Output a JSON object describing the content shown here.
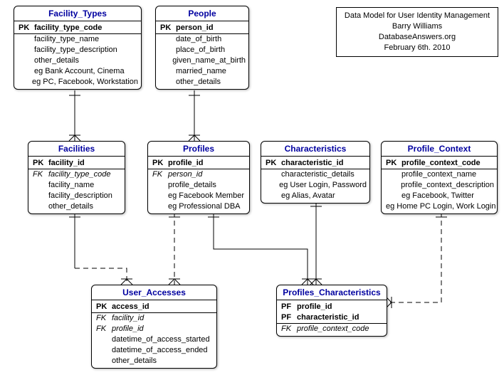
{
  "info": {
    "line1": "Data Model for User Identity Management",
    "line2": "Barry Williams",
    "line3": "DatabaseAnswers.org",
    "line4": "February 6th. 2010"
  },
  "entities": {
    "facility_types": {
      "title": "Facility_Types",
      "pk": "facility_type_code",
      "a1": "facility_type_name",
      "a2": "facility_type_description",
      "a3": "other_details",
      "a4": "eg Bank Account, Cinema",
      "a5": "eg PC, Facebook, Workstation"
    },
    "people": {
      "title": "People",
      "pk": "person_id",
      "a1": "date_of_birth",
      "a2": "place_of_birth",
      "a3": "given_name_at_birth",
      "a4": "married_name",
      "a5": "other_details"
    },
    "facilities": {
      "title": "Facilities",
      "pk": "facility_id",
      "fk1": "facility_type_code",
      "a1": "facility_name",
      "a2": "facility_description",
      "a3": "other_details"
    },
    "profiles": {
      "title": "Profiles",
      "pk": "profile_id",
      "fk1": "person_id",
      "a1": "profile_details",
      "a2": "eg Facebook Member",
      "a3": "eg Professional DBA"
    },
    "characteristics": {
      "title": "Characteristics",
      "pk": "characteristic_id",
      "a1": "characteristic_details",
      "a2": "eg User Login, Password",
      "a3": "eg Alias, Avatar"
    },
    "profile_context": {
      "title": "Profile_Context",
      "pk": "profile_context_code",
      "a1": "profile_context_name",
      "a2": "profile_context_description",
      "a3": "eg Facebook, Twitter",
      "a4": "eg Home PC Login, Work Login"
    },
    "user_accesses": {
      "title": "User_Accesses",
      "pk": "access_id",
      "fk1": "facility_id",
      "fk2": "profile_id",
      "a1": "datetime_of_access_started",
      "a2": "datetime_of_access_ended",
      "a3": "other_details"
    },
    "profiles_characteristics": {
      "title": "Profiles_Characteristics",
      "pf1": "profile_id",
      "pf2": "characteristic_id",
      "fk1": "profile_context_code"
    }
  },
  "labels": {
    "pk": "PK",
    "fk": "FK",
    "pf": "PF"
  }
}
